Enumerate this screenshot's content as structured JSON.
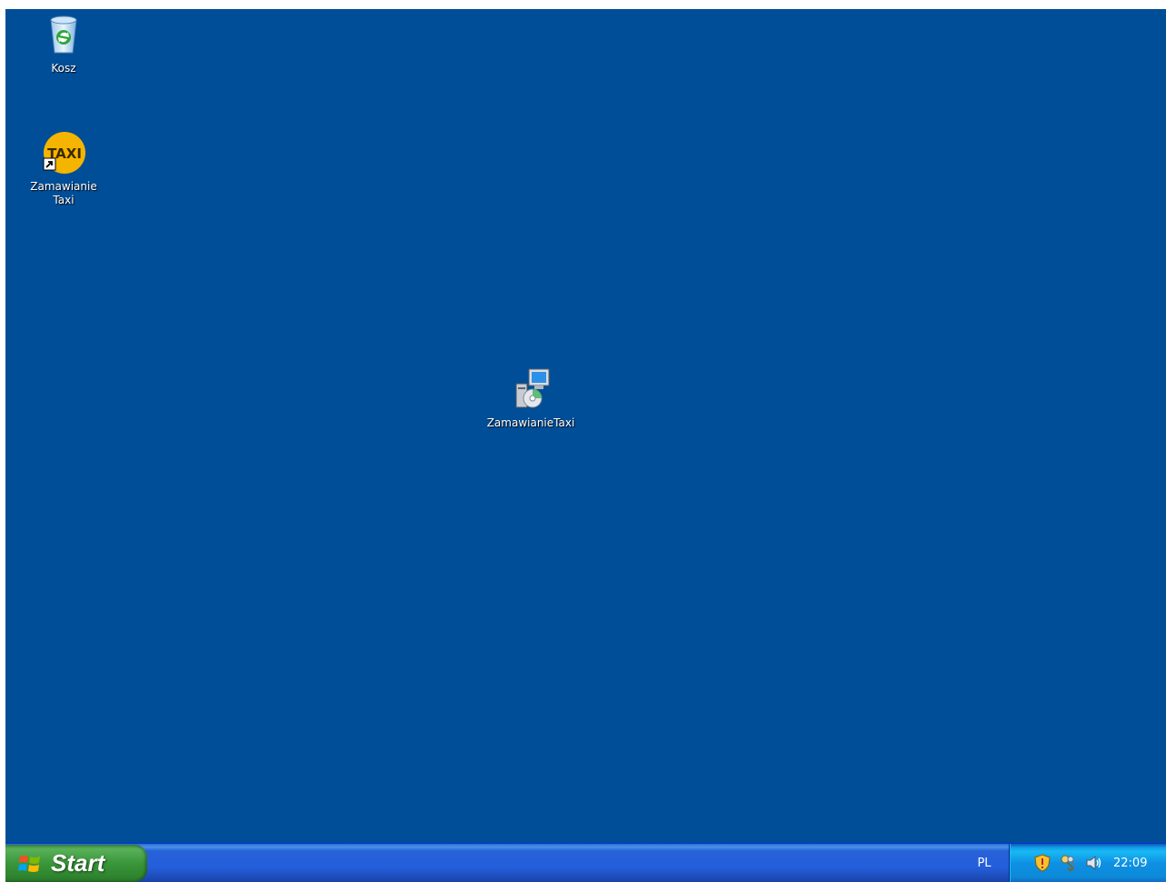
{
  "desktop": {
    "background_color": "#004e98",
    "icons": [
      {
        "label": "Kosz",
        "icon": "recycle-bin-icon"
      },
      {
        "label": "Zamawianie\nTaxi",
        "icon": "taxi-shortcut-icon"
      },
      {
        "label": "ZamawianieTaxi",
        "icon": "installer-icon"
      }
    ]
  },
  "taskbar": {
    "start_label": "Start",
    "start_color": "#3a963a",
    "language": "PL",
    "tray": {
      "icons": [
        "security-shield-icon",
        "network-keys-icon",
        "volume-icon"
      ],
      "clock": "22:09"
    }
  }
}
